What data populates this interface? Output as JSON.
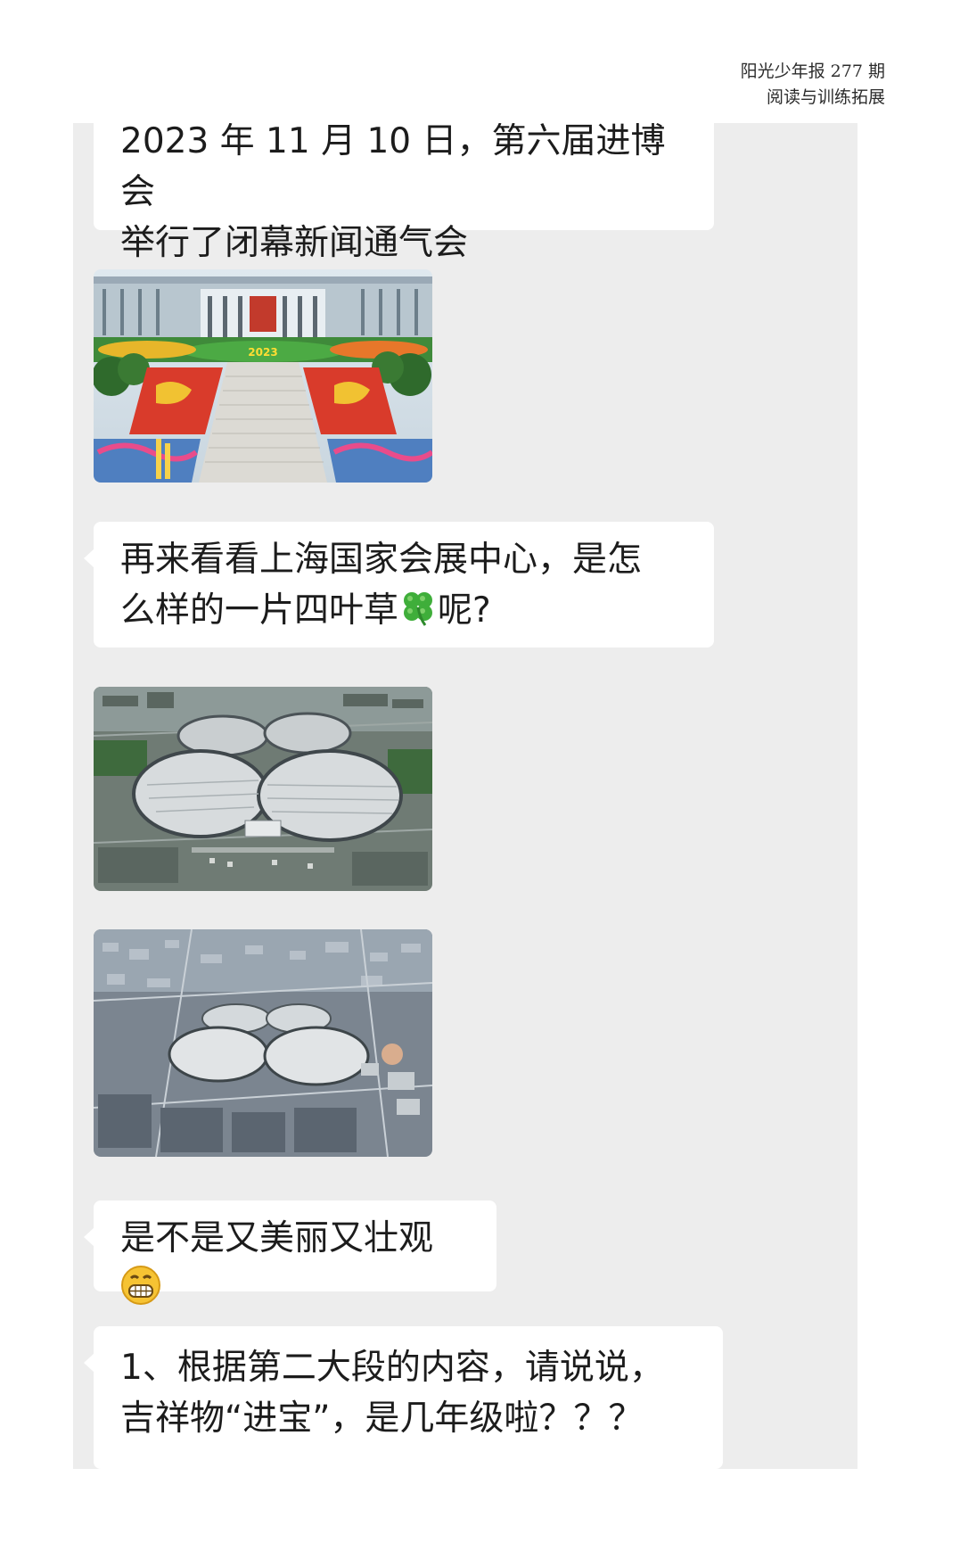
{
  "header": {
    "line1": "阳光少年报 277 期",
    "line2": "阅读与训练拓展"
  },
  "messages": {
    "m1": {
      "line1": "2023 年 11 月 10 日，第六届进博会",
      "line2": "举行了闭幕新闻通气会"
    },
    "m3": {
      "line1": "再来看看上海国家会展中心，是怎",
      "line2a": "么样的一片四叶草",
      "line2b": "呢?"
    },
    "m6": {
      "text": "是不是又美丽又壮观"
    },
    "m7": {
      "line1": "1、根据第二大段的内容，请说说，",
      "line2": "吉祥物“进宝”，是几年级啦？？？"
    }
  },
  "images": {
    "img1": {
      "caption": "2023"
    }
  },
  "icons": {
    "clover": "four-leaf-clover-icon",
    "grin": "grinning-face-icon"
  },
  "colors": {
    "chat_bg": "#ededed",
    "bubble_bg": "#ffffff",
    "clover_green": "#3fae3a",
    "emoji_yellow": "#f6c333"
  }
}
